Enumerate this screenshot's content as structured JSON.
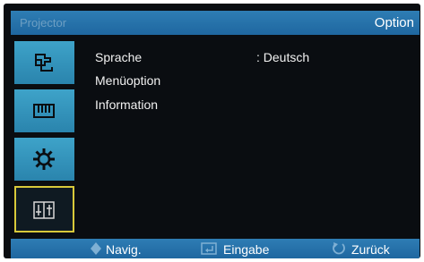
{
  "window": {
    "title": "Projector",
    "section": "Option"
  },
  "sidebar": {
    "items": [
      {
        "icon": "input-source-icon"
      },
      {
        "icon": "picture-settings-icon"
      },
      {
        "icon": "gear-icon"
      },
      {
        "icon": "option-icon",
        "active": true
      }
    ]
  },
  "menu": {
    "rows": [
      {
        "label": "Sprache",
        "value": ": Deutsch"
      },
      {
        "label": "Menüoption",
        "value": ""
      },
      {
        "label": "Information",
        "value": ""
      }
    ]
  },
  "footer": {
    "navigate": "Navig.",
    "enter": "Eingabe",
    "back": "Zurück"
  },
  "colors": {
    "accent_bar": "#2574aa",
    "sidebar_tile": "#3ea3c9",
    "active_border": "#d8c93a",
    "background": "#0a0d11"
  }
}
